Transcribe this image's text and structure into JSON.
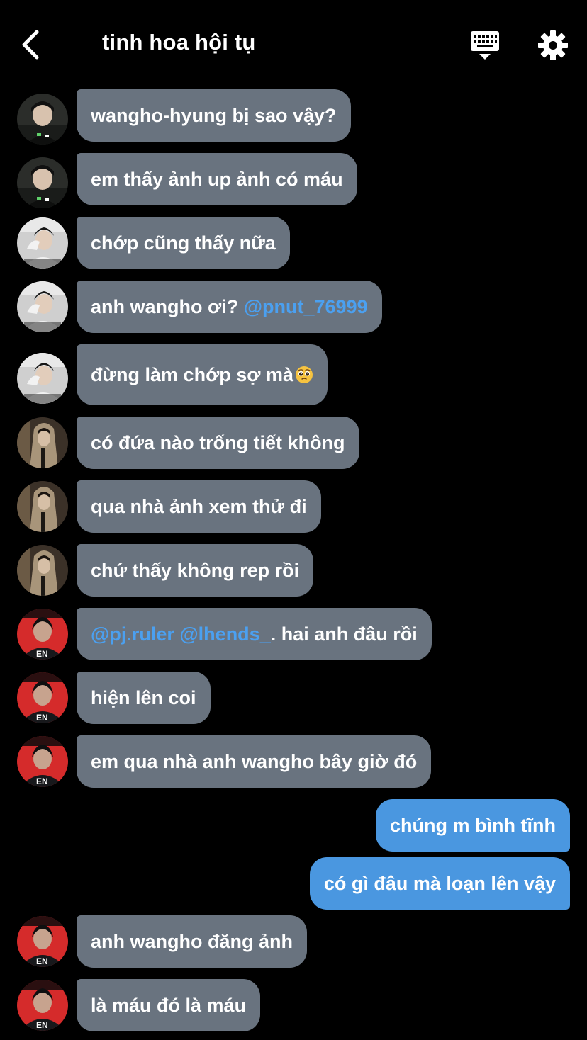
{
  "header": {
    "title": "tinh hoa hội tụ",
    "back_icon": "chevron-left-icon",
    "keyboard_icon": "keyboard-icon",
    "settings_icon": "gear-icon"
  },
  "colors": {
    "background": "#000000",
    "incoming_bubble": "#69737f",
    "outgoing_bubble": "#4a97e0",
    "mention": "#4ba0f0"
  },
  "messages": [
    {
      "sender": "avatar-a",
      "text": "wangho-hyung bị sao vậy?"
    },
    {
      "sender": "avatar-a",
      "text": "em thấy ảnh up ảnh có máu"
    },
    {
      "sender": "avatar-b",
      "text": "chớp cũng thấy nữa"
    },
    {
      "sender": "avatar-b",
      "text_before": "anh wangho ơi? ",
      "mention": "@pnut_76999"
    },
    {
      "sender": "avatar-b",
      "text": "đừng làm chớp sợ mà",
      "emoji": "pleading-face-emoji"
    },
    {
      "sender": "avatar-c",
      "text": "có đứa nào trống tiết không"
    },
    {
      "sender": "avatar-c",
      "text": "qua nhà ảnh xem thử đi"
    },
    {
      "sender": "avatar-c",
      "text": "chứ thấy không rep rồi"
    },
    {
      "sender": "avatar-d",
      "mention": "@pj.ruler @lhends_",
      "text_after": ". hai anh đâu rồi"
    },
    {
      "sender": "avatar-d",
      "text": "hiện lên coi"
    },
    {
      "sender": "avatar-d",
      "text": "em qua nhà anh wangho bây giờ đó"
    },
    {
      "sender": "me",
      "text": "chúng m bình tĩnh"
    },
    {
      "sender": "me",
      "text": "có gì đâu mà loạn lên vậy"
    },
    {
      "sender": "avatar-d",
      "text": "anh wangho đăng ảnh"
    },
    {
      "sender": "avatar-d",
      "text": "là máu đó là máu"
    }
  ]
}
